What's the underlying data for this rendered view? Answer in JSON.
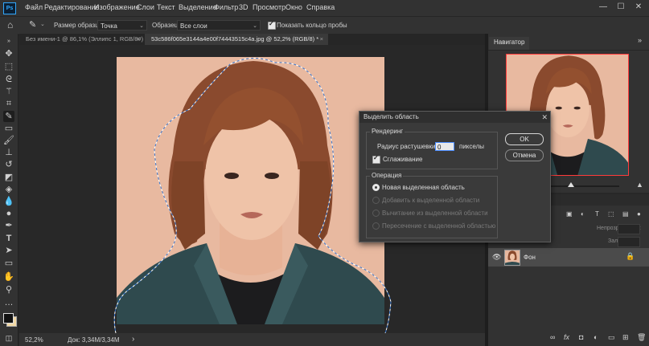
{
  "app": {
    "logo": "Ps",
    "menu": [
      "Файл",
      "Редактирование",
      "Изображение",
      "Слои",
      "Текст",
      "Выделение",
      "Фильтр",
      "3D",
      "Просмотр",
      "Окно",
      "Справка"
    ],
    "window_controls": [
      "—",
      "☐",
      "✕"
    ]
  },
  "options_bar": {
    "sample_size_label": "Размер образца:",
    "sample_size_value": "Точка",
    "sample_label": "Образец:",
    "sample_value": "Все слои",
    "show_ring_label": "Показать кольцо пробы",
    "show_ring_checked": true
  },
  "tabs": [
    {
      "label": "Без имени-1 @ 86,1% (Эллипс 1, RGB/8#)",
      "close": "×",
      "active": false
    },
    {
      "label": "53c586f065e3144a4e00f74443515c4a.jpg @ 52,2% (RGB/8) *",
      "close": "×",
      "active": true
    }
  ],
  "status_bar": {
    "zoom": "52,2%",
    "doc_info": "Док: 3,34M/3,34M",
    "arrow": "›"
  },
  "navigator": {
    "tab": "Навигатор",
    "close_icon": "»"
  },
  "layers": {
    "opacity_label": "Непрозрачность:",
    "fill_label": "Заливка:",
    "layer_name": "Фон"
  },
  "dialog": {
    "title": "Выделить область",
    "close": "✕",
    "rendering_group": "Рендеринг",
    "feather_label": "Радиус растушевки:",
    "feather_value": "0",
    "feather_unit": "пикселы",
    "antialias_label": "Сглаживание",
    "antialias_checked": true,
    "operation_group": "Операция",
    "operations": [
      {
        "label": "Новая выделенная область",
        "selected": true,
        "enabled": true
      },
      {
        "label": "Добавить к выделенной области",
        "selected": false,
        "enabled": false
      },
      {
        "label": "Вычитание из выделенной области",
        "selected": false,
        "enabled": false
      },
      {
        "label": "Пересечение с выделенной областью",
        "selected": false,
        "enabled": false
      }
    ],
    "ok_label": "OK",
    "cancel_label": "Отмена"
  },
  "colors": {
    "accent": "#31a8ff",
    "photo_bg": "#e8b9a0",
    "hair": "#8a4a2e",
    "jacket": "#2f4a4e",
    "selection": "#6aaeff"
  }
}
